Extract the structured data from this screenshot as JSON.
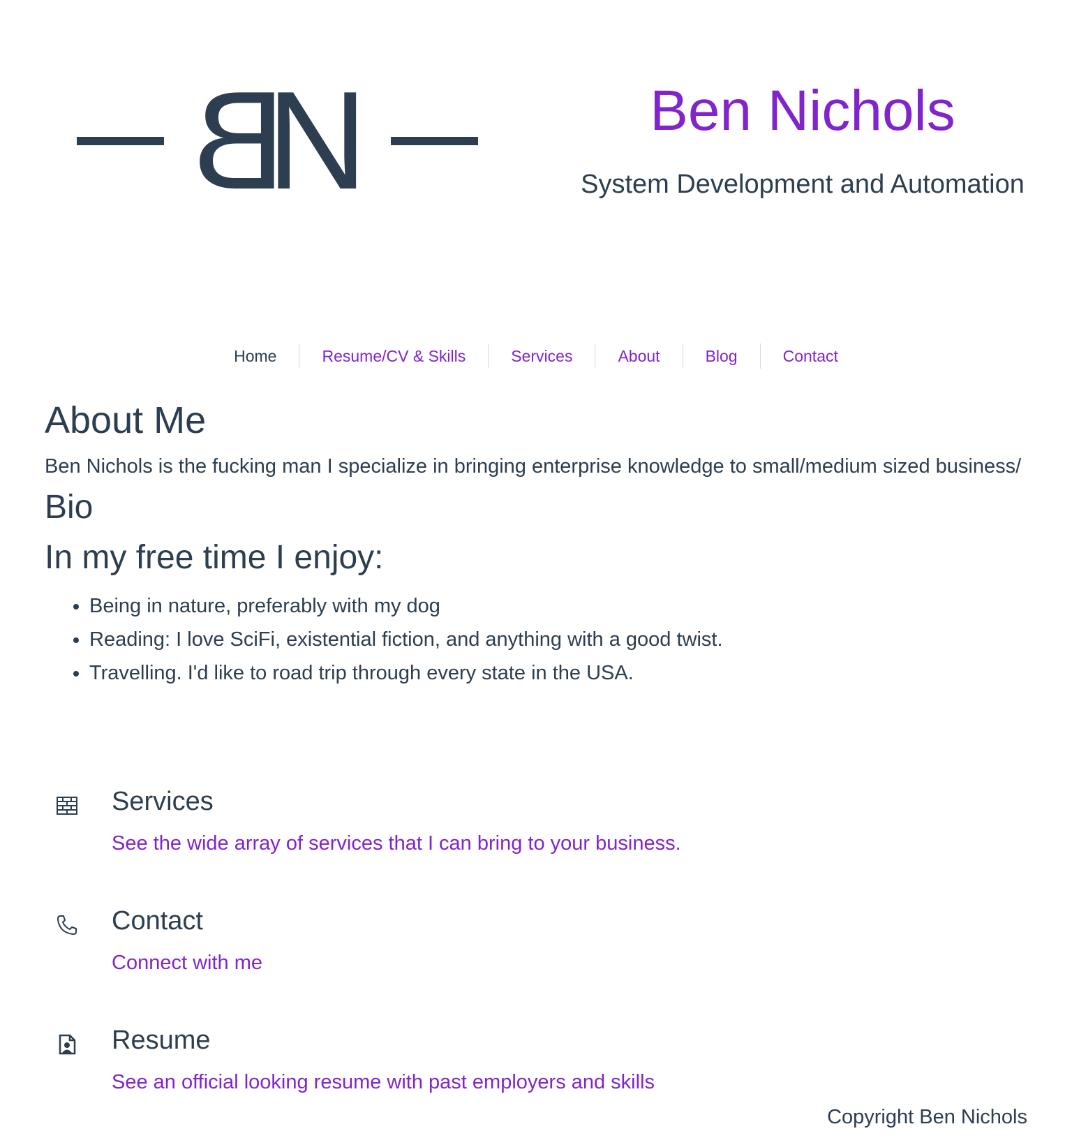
{
  "theme": {
    "accent_color": "#8224cc",
    "text_color": "#2c3e50",
    "background_color": "#ffffff"
  },
  "header": {
    "logo_text": "BN",
    "site_title": "Ben Nichols",
    "tagline": "System Development and Automation"
  },
  "nav": {
    "items": [
      {
        "label": "Home",
        "current": true
      },
      {
        "label": "Resume/CV & Skills",
        "current": false
      },
      {
        "label": "Services",
        "current": false
      },
      {
        "label": "About",
        "current": false
      },
      {
        "label": "Blog",
        "current": false
      },
      {
        "label": "Contact",
        "current": false
      }
    ]
  },
  "about": {
    "title": "About Me",
    "intro": "Ben Nichols is the fucking man I specialize in bringing enterprise knowledge to small/medium sized business/",
    "bio_title": "Bio",
    "free_time_title": "In my free time I enjoy:",
    "hobbies": [
      "Being in nature, preferably with my dog",
      "Reading: I love SciFi, existential fiction, and anything with a good twist.",
      "Travelling. I'd like to road trip through every state in the USA."
    ]
  },
  "features": [
    {
      "icon": "brick-wall-icon",
      "title": "Services",
      "link_text": "See the wide array of services that I can bring to your business."
    },
    {
      "icon": "phone-icon",
      "title": "Contact",
      "link_text": "Connect with me"
    },
    {
      "icon": "resume-file-icon",
      "title": "Resume",
      "link_text": "See an official looking resume with past employers and skills"
    }
  ],
  "footer": {
    "copyright": "Copyright Ben Nichols"
  }
}
